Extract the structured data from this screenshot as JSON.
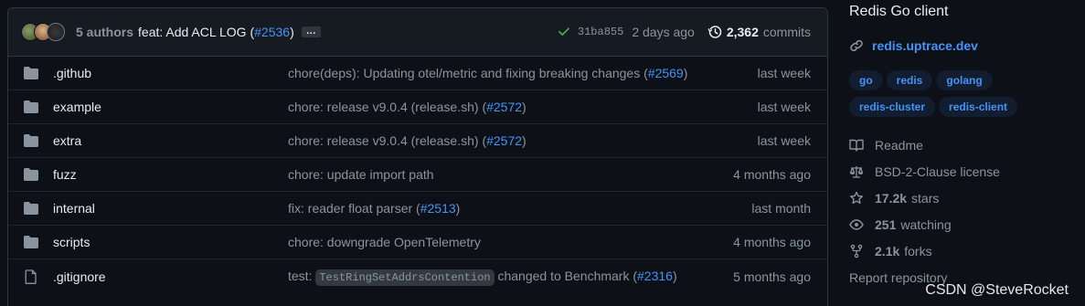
{
  "commit_bar": {
    "authors": "5 authors",
    "message_prefix": "feat: Add ACL LOG (",
    "message_pr": "#2536",
    "message_suffix": ")",
    "ellipsis": "…",
    "sha": "31ba855",
    "time": "2 days ago",
    "commit_count": "2,362",
    "commits_label": "commits"
  },
  "files": [
    {
      "name": ".github",
      "type": "folder",
      "msg": "chore(deps): Updating otel/metric and fixing breaking changes (",
      "pr": "#2569",
      "msg_end": ")",
      "date": "last week"
    },
    {
      "name": "example",
      "type": "folder",
      "msg": "chore: release v9.0.4 (release.sh) (",
      "pr": "#2572",
      "msg_end": ")",
      "date": "last week"
    },
    {
      "name": "extra",
      "type": "folder",
      "msg": "chore: release v9.0.4 (release.sh) (",
      "pr": "#2572",
      "msg_end": ")",
      "date": "last week"
    },
    {
      "name": "fuzz",
      "type": "folder",
      "msg": "chore: update import path",
      "pr": "",
      "msg_end": "",
      "date": "4 months ago"
    },
    {
      "name": "internal",
      "type": "folder",
      "msg": "fix: reader float parser (",
      "pr": "#2513",
      "msg_end": ")",
      "date": "last month"
    },
    {
      "name": "scripts",
      "type": "folder",
      "msg": "chore: downgrade OpenTelemetry",
      "pr": "",
      "msg_end": "",
      "date": "4 months ago"
    },
    {
      "name": ".gitignore",
      "type": "file",
      "msg": "test: ",
      "code": "TestRingSetAddrsContention",
      "msg_after_code": " changed to Benchmark (",
      "pr": "#2316",
      "msg_end": ")",
      "date": "5 months ago"
    }
  ],
  "sidebar": {
    "description": "Redis Go client",
    "homepage": "redis.uptrace.dev",
    "topics": [
      "go",
      "redis",
      "golang",
      "redis-cluster",
      "redis-client"
    ],
    "readme": "Readme",
    "license": "BSD-2-Clause license",
    "stars_count": "17.2k",
    "stars_label": "stars",
    "watching_count": "251",
    "watching_label": "watching",
    "forks_count": "2.1k",
    "forks_label": "forks",
    "report": "Report repository"
  },
  "watermark": "CSDN @SteveRocket",
  "colors": {
    "link": "#4493f8",
    "success": "#3fb950",
    "muted": "#8b949e",
    "background": "#0d1117"
  }
}
